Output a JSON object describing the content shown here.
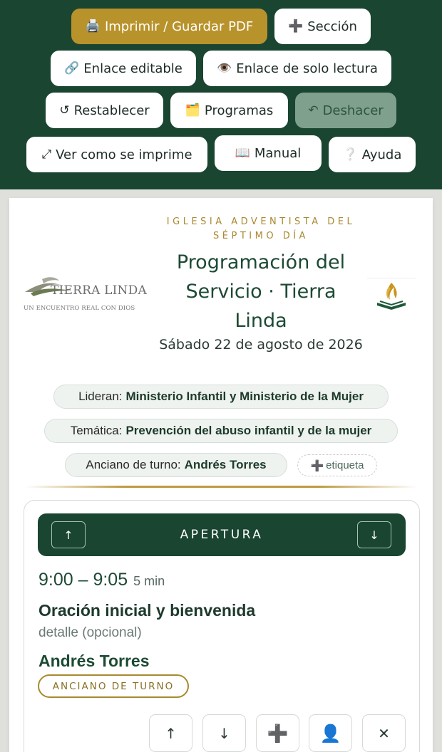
{
  "toolbar": {
    "print": {
      "icon": "printer-icon",
      "glyph": "🖨️",
      "label": "Imprimir / Guardar PDF"
    },
    "section": {
      "icon": "plus-icon",
      "glyph": "➕",
      "label": "Sección"
    },
    "edit_link": {
      "icon": "link-icon",
      "glyph": "🔗",
      "label": "Enlace editable"
    },
    "readonly_link": {
      "icon": "eye-icon",
      "glyph": "👁️",
      "label": "Enlace de solo lectura"
    },
    "reset": {
      "icon": "reset-icon",
      "glyph": "↺",
      "label": "Restablecer"
    },
    "programs": {
      "icon": "folder-icon",
      "glyph": "🗂️",
      "label": "Programas"
    },
    "undo": {
      "icon": "undo-icon",
      "glyph": "↶",
      "label": "Deshacer"
    },
    "preview": {
      "icon": "expand-icon",
      "glyph": "⤢",
      "label": "Ver como se imprime"
    },
    "manual": {
      "icon": "book-icon",
      "glyph": "📖",
      "label": "Manual"
    },
    "help": {
      "icon": "question-icon",
      "glyph": "❔",
      "label": "Ayuda"
    }
  },
  "header": {
    "logo_left": {
      "brand": "TIERRA LINDA",
      "tagline": "UN ENCUENTRO REAL CON DIOS"
    },
    "church": "IGLESIA ADVENTISTA DEL SÉPTIMO DÍA",
    "title": "Programación del Servicio · Tierra Linda",
    "date": "Sábado 22 de agosto de 2026"
  },
  "tags": {
    "leaders": {
      "label": "Lideran:",
      "value": "Ministerio Infantil y Ministerio de la Mujer"
    },
    "theme": {
      "label": "Temática:",
      "value": "Prevención del abuso infantil y de la mujer"
    },
    "elder": {
      "label": "Anciano de turno:",
      "value": "Andrés Torres"
    },
    "add_tag": {
      "glyph": "➕",
      "label": "etiqueta"
    }
  },
  "section": {
    "title": "APERTURA",
    "up_glyph": "↑",
    "down_glyph": "↓",
    "item": {
      "time": "9:00 – 9:05",
      "duration": "5 min",
      "title": "Oración inicial y bienvenida",
      "detail_placeholder": "detalle (opcional)",
      "person": "Andrés Torres",
      "role": "ANCIANO DE TURNO"
    },
    "actions": {
      "up": "↑",
      "down": "↓",
      "add": "➕",
      "person": "👤",
      "delete": "✕"
    }
  },
  "colors": {
    "primary_green": "#194531",
    "gold": "#b8922a",
    "undo_disabled": "#7ea08d"
  }
}
